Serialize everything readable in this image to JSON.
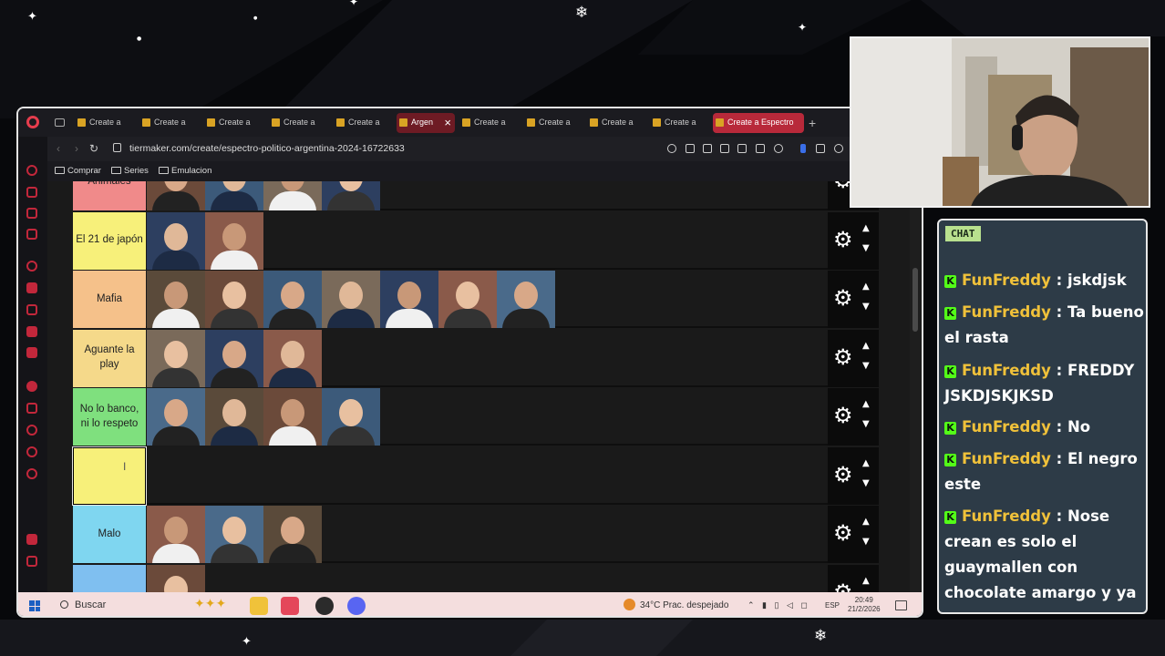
{
  "browser": {
    "tabs": [
      {
        "label": "Create a",
        "state": "normal"
      },
      {
        "label": "Create a",
        "state": "normal"
      },
      {
        "label": "Create a",
        "state": "normal"
      },
      {
        "label": "Create a",
        "state": "normal"
      },
      {
        "label": "Create a",
        "state": "normal"
      },
      {
        "label": "Argen",
        "state": "active"
      },
      {
        "label": "Create a",
        "state": "normal"
      },
      {
        "label": "Create a",
        "state": "normal"
      },
      {
        "label": "Create a",
        "state": "normal"
      },
      {
        "label": "Create a",
        "state": "normal"
      },
      {
        "label": "Create a Espectro",
        "state": "highlight"
      }
    ],
    "url": "tiermaker.com/create/espectro-politico-argentina-2024-16722633",
    "bookmarks": [
      "Comprar",
      "Series",
      "Emulacion"
    ]
  },
  "tierlist": {
    "tiers": [
      {
        "label": "Animales",
        "color": "#f08a8a",
        "images": 4
      },
      {
        "label": "El 21 de japón",
        "color": "#f7f07a",
        "images": 2
      },
      {
        "label": "Mafia",
        "color": "#f5c18a",
        "images": 7
      },
      {
        "label": "Aguante la play",
        "color": "#f5d98a",
        "images": 3
      },
      {
        "label": "No lo banco, ni lo respeto",
        "color": "#7fe07e",
        "images": 4
      },
      {
        "label": "",
        "color": "#f7f07a",
        "images": 0
      },
      {
        "label": "Malo",
        "color": "#7fd6f0",
        "images": 3
      },
      {
        "label": "",
        "color": "#7fbff0",
        "images": 1
      }
    ]
  },
  "taskbar": {
    "search_label": "Buscar",
    "weather": "34°C  Prac. despejado",
    "lang": "ESP",
    "time": "20:49",
    "date": "21/2/2026",
    "notification_count": "9"
  },
  "chat": {
    "badge": "CHAT",
    "messages": [
      {
        "user": "FunFreddy",
        "text": "jskdjsk"
      },
      {
        "user": "FunFreddy",
        "text": "Ta bueno el rasta"
      },
      {
        "user": "FunFreddy",
        "text": "FREDDY JSKDJSKJKSD"
      },
      {
        "user": "FunFreddy",
        "text": "No"
      },
      {
        "user": "FunFreddy",
        "text": "El negro este"
      },
      {
        "user": "FunFreddy",
        "text": "Nose crean es solo el guaymallen con chocolate amargo y ya"
      }
    ]
  },
  "colors": {
    "accent": "#c2273b",
    "chat_bg": "#2d3b47",
    "username": "#f0c13a",
    "kick_green": "#53fc18"
  }
}
